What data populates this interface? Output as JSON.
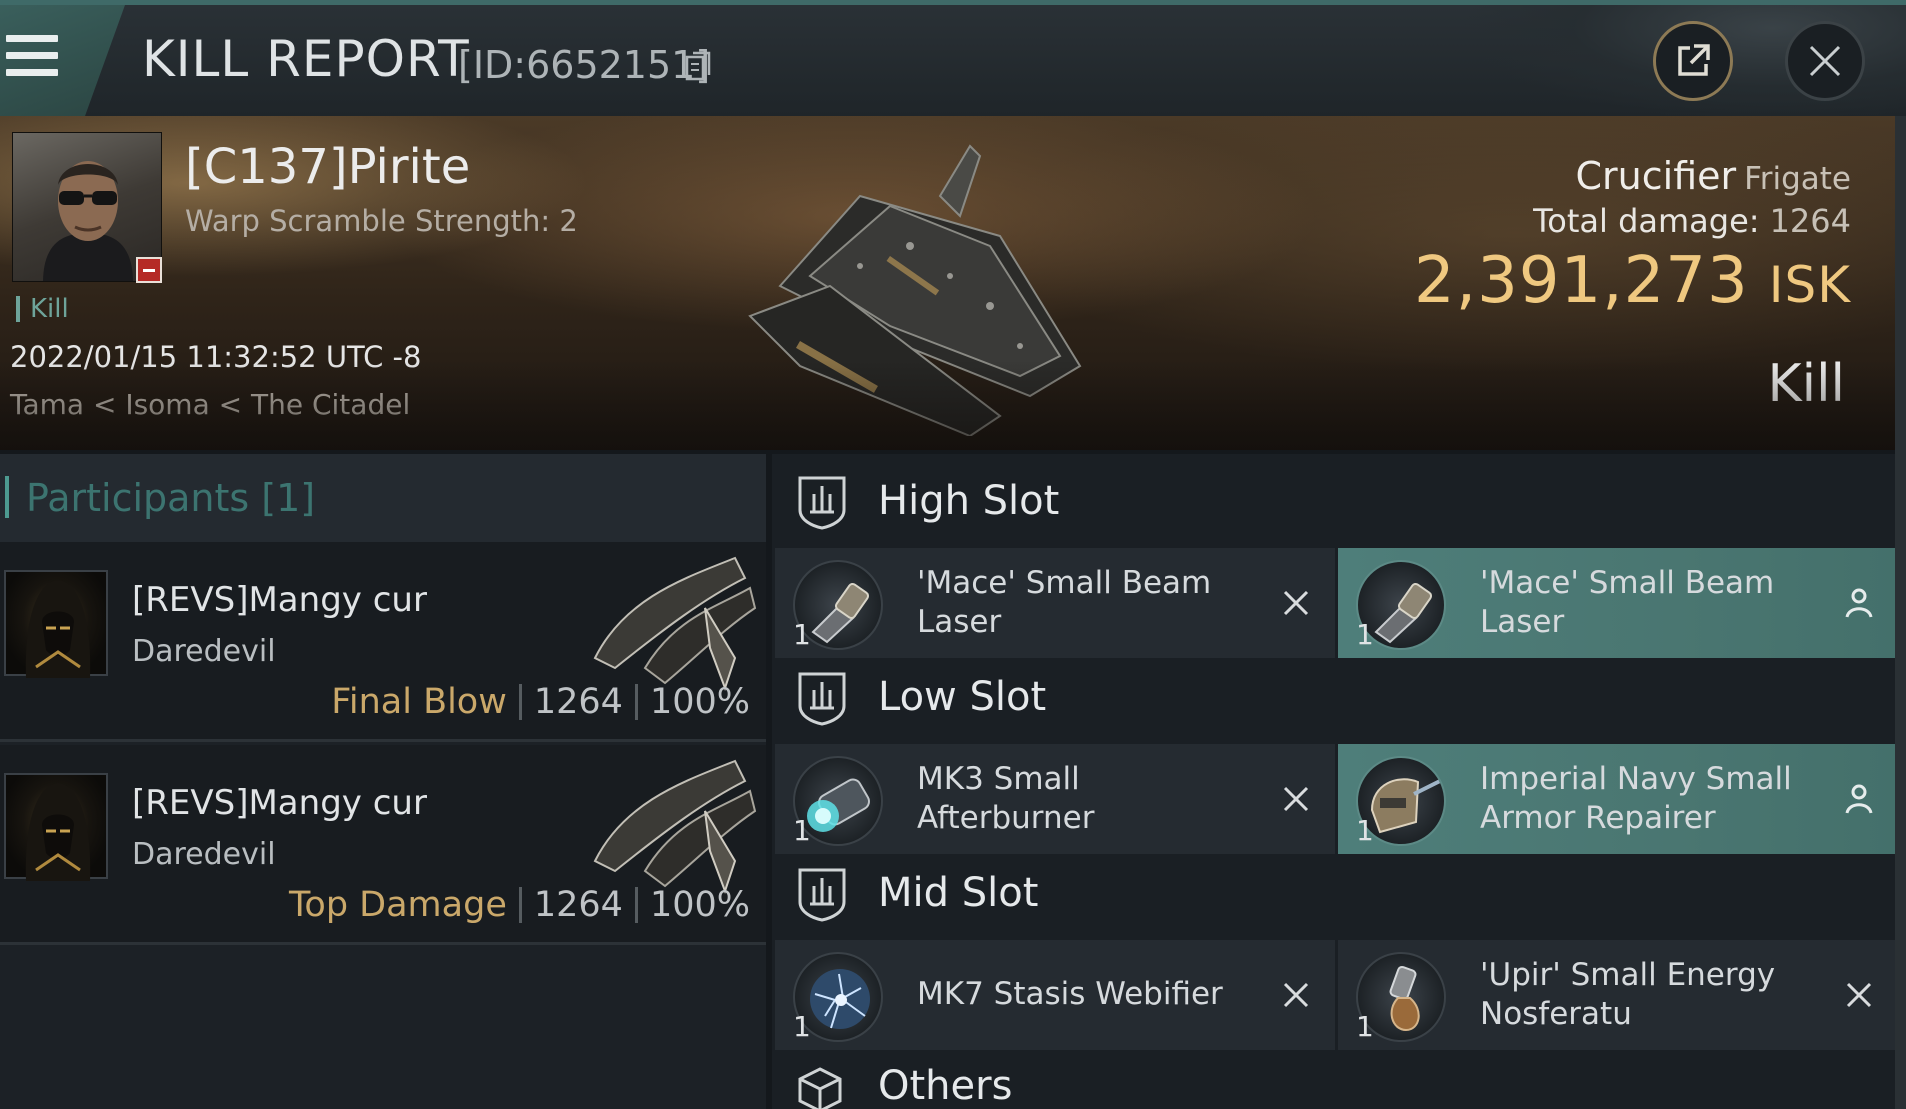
{
  "header": {
    "title": "KILL REPORT",
    "id_text": "[ID:6652151]",
    "share_icon": "external-link-icon",
    "close_icon": "close-icon",
    "menu_icon": "hamburger-menu-icon"
  },
  "victim": {
    "name": "[C137]Pirite",
    "warp_scramble": "Warp Scramble Strength: 2",
    "kill_tag": "Kill",
    "datetime": "2022/01/15 11:32:52 UTC -8",
    "location": "Tama < Isoma < The Citadel",
    "ship_name": "Crucifier",
    "ship_class": "Frigate",
    "total_damage_label": "Total damage:",
    "total_damage_value": "1264",
    "isk_value": "2,391,273",
    "isk_unit": "ISK",
    "result": "Kill"
  },
  "participants": {
    "title": "Participants [1]",
    "rows": [
      {
        "name": "[REVS]Mangy cur",
        "ship": "Daredevil",
        "role": "Final Blow",
        "damage": "1264",
        "percent": "100%"
      },
      {
        "name": "[REVS]Mangy cur",
        "ship": "Daredevil",
        "role": "Top Damage",
        "damage": "1264",
        "percent": "100%"
      }
    ]
  },
  "fitting": {
    "high_slot": {
      "label": "High Slot",
      "items": [
        {
          "qty": "1",
          "name": "'Mace' Small Beam Laser",
          "status": "destroyed"
        },
        {
          "qty": "1",
          "name": "'Mace' Small Beam Laser",
          "status": "dropped"
        }
      ]
    },
    "low_slot": {
      "label": "Low Slot",
      "items": [
        {
          "qty": "1",
          "name": "MK3 Small Afterburner",
          "status": "destroyed"
        },
        {
          "qty": "1",
          "name": "Imperial Navy Small Armor Repairer",
          "status": "dropped"
        }
      ]
    },
    "mid_slot": {
      "label": "Mid Slot",
      "items": [
        {
          "qty": "1",
          "name": "MK7 Stasis Webifier",
          "status": "destroyed"
        },
        {
          "qty": "1",
          "name": "'Upir' Small Energy Nosferatu",
          "status": "destroyed"
        }
      ]
    },
    "others": {
      "label": "Others"
    }
  },
  "colors": {
    "accent_teal": "#4d9a90",
    "isk_gold": "#efc880",
    "role_gold": "#caa86a",
    "dropped_bg": "#4e7e7a",
    "destroyed_bg": "#252b31"
  }
}
